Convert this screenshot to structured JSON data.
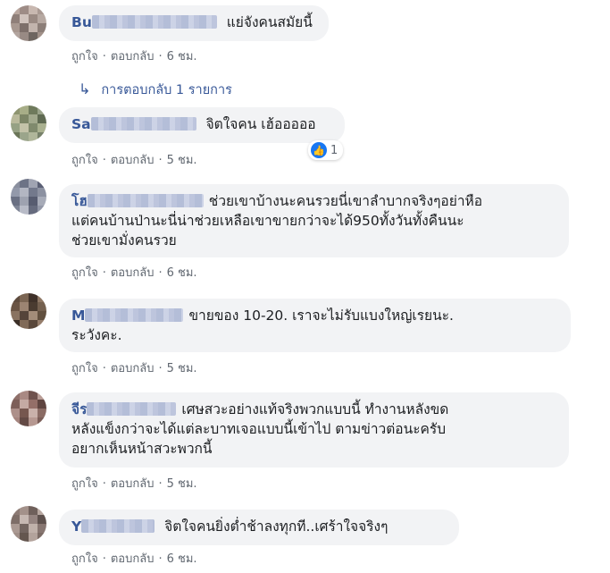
{
  "meta_labels": {
    "like": "ถูกใจ",
    "reply": "ตอบกลับ",
    "separator": "·"
  },
  "reply_toggle": {
    "icon": "reply-arrow-icon",
    "label": "การตอบกลับ 1 รายการ"
  },
  "comments": [
    {
      "author_visible": "Bu",
      "text": "แย่จังคนสมัยนี้",
      "time": "6 ชม."
    },
    {
      "author_visible": "Sa",
      "text": "จิตใจคน เฮ้อออออ",
      "time": "5 ชม.",
      "reaction": {
        "icon": "like-icon",
        "count": "1",
        "color": "#1877f2"
      }
    },
    {
      "author_visible": "โฮ",
      "text_lines": [
        "ช่วยเขาบ้างนะคนรวยนี่เขาลำบากจริงๆอย่าหือ",
        "แต่คนบ้านป่านะนี่น่าช่วยเหลือเขาขายกว่าจะได้950ทั้งวันทั้งคืนนะ",
        "ช่วยเขามั่งคนรวย"
      ],
      "time": "6 ชม."
    },
    {
      "author_visible": "M",
      "text_lines": [
        "ขายของ 10-20. เราจะไม่รับแบงใหญ่เรยนะ.",
        "ระวังคะ."
      ],
      "time": "5 ชม."
    },
    {
      "author_visible": "จีร",
      "text_lines": [
        "เศษสวะอย่างแท้จริงพวกแบบนี้ ทำงานหลังขด",
        "หลังแข็งกว่าจะได้แต่ละบาทเจอแบบนี้เข้าไป ตามข่าวต่อนะครับ",
        "อยากเห็นหน้าสวะพวกนี้"
      ],
      "time": "5 ชม."
    },
    {
      "author_visible": "Y",
      "text": "จิตใจคนยิ่งต่ำช้าลงทุกที..เศร้าใจจริงๆ",
      "time": "6 ชม."
    }
  ],
  "colors": {
    "author": "#385898",
    "bubble": "#f2f3f5",
    "meta": "#606770"
  }
}
